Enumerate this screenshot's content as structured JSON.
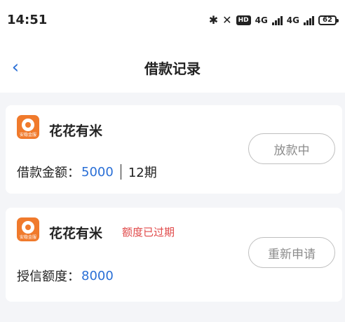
{
  "status_bar": {
    "time": "14:51",
    "network1": "4G",
    "network2": "4G",
    "hd_label": "HD",
    "battery": "62"
  },
  "nav": {
    "back_icon": "‹",
    "title": "借款记录"
  },
  "records": [
    {
      "app_name": "花花有米",
      "logo_caption": "安稳金服",
      "amount_label": "借款金额：",
      "amount_value": "5000",
      "term": "12期",
      "action_label": "放款中"
    },
    {
      "app_name": "花花有米",
      "logo_caption": "安稳金服",
      "status_tag": "额度已过期",
      "credit_label": "授信额度：",
      "credit_value": "8000",
      "action_label": "重新申请"
    }
  ],
  "colors": {
    "accent_blue": "#2a6fd6",
    "expired_red": "#e04848",
    "logo_orange": "#f07a2c"
  }
}
